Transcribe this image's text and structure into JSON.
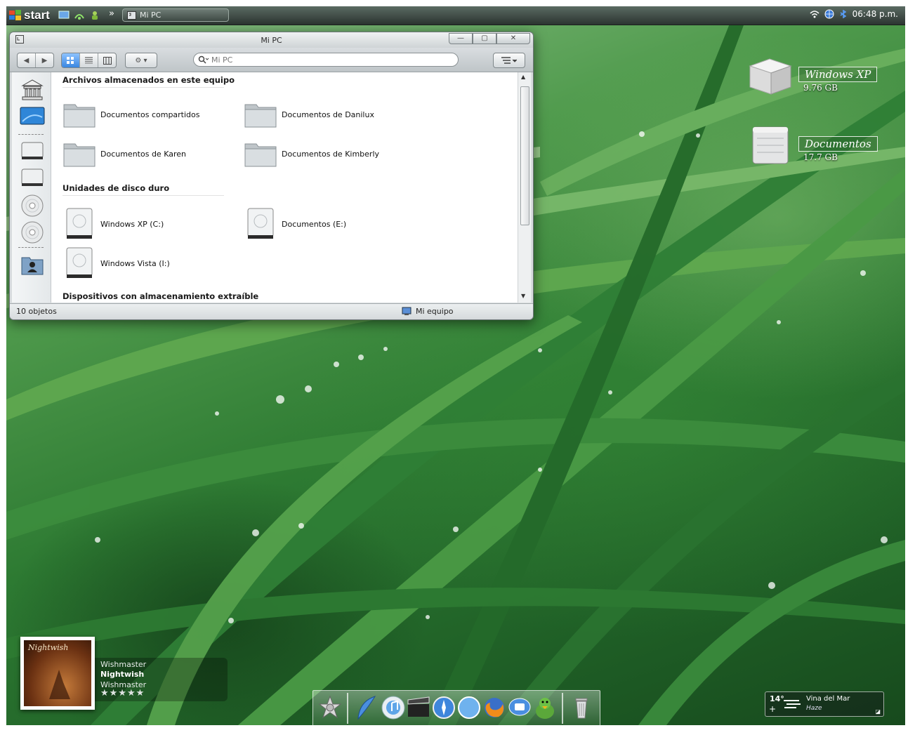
{
  "taskbar": {
    "start_label": "start",
    "window_button_label": "Mi PC",
    "more_glyph": "»",
    "clock": "06:48 p.m."
  },
  "window": {
    "title": "Mi PC",
    "search_placeholder": "Mi PC",
    "sections": [
      {
        "title": "Archivos almacenados en este equipo",
        "items": [
          "Documentos compartidos",
          "Documentos de Danilux",
          "Documentos de Karen",
          "Documentos de Kimberly"
        ]
      },
      {
        "title": "Unidades de disco duro",
        "items": [
          "Windows XP (C:)",
          "Documentos (E:)",
          "Windows Vista (I:)"
        ]
      },
      {
        "title": "Dispositivos con almacenamiento extraíble",
        "items": []
      }
    ],
    "status_count": "10 objetos",
    "status_location": "Mi equipo"
  },
  "desktop_icons": [
    {
      "label": "Windows XP",
      "size": "9.76 GB",
      "icon": "box-icon"
    },
    {
      "label": "Documentos",
      "size": "17.7 GB",
      "icon": "drive-icon"
    }
  ],
  "music": {
    "cover_text": "Nightwish",
    "line1": "Wishmaster",
    "line2": "Nightwish",
    "line3": "Wishmaster",
    "stars": "★★★★★"
  },
  "weather": {
    "temp": "14°",
    "city": "Vina del Mar",
    "condition": "Haze"
  },
  "colors": {
    "accent": "#3a86e0",
    "grass_dark": "#1f5f26",
    "grass_light": "#8fc28a"
  }
}
